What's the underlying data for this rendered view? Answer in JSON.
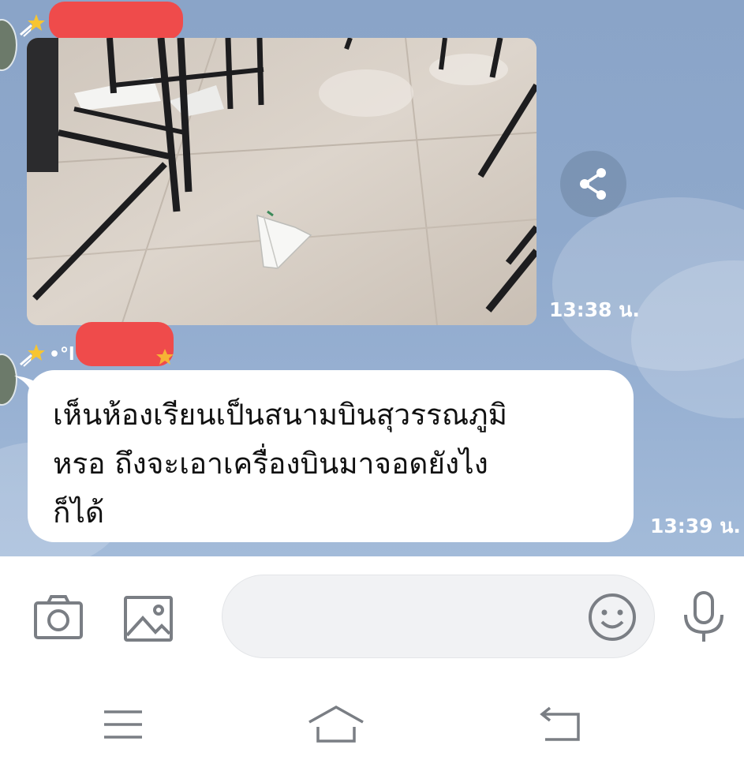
{
  "messages": [
    {
      "type": "image",
      "sender_prefix": "•",
      "timestamp": "13:38 น."
    },
    {
      "type": "text",
      "sender_prefix": "•°l",
      "lines": [
        "เห็นห้องเรียนเป็นสนามบินสุวรรณภูมิ",
        "หรอ ถึงจะเอาเครื่องบินมาจอดยังไง",
        "ก็ได้"
      ],
      "timestamp": "13:39 น."
    }
  ],
  "icons": {
    "sender_badge": "shooting-star-icon",
    "share": "share-icon",
    "camera": "camera-icon",
    "gallery": "image-icon",
    "emoji": "smiley-icon",
    "mic": "microphone-icon",
    "nav_menu": "menu-icon",
    "nav_home": "home-icon",
    "nav_back": "back-icon"
  },
  "colors": {
    "chat_background": "#8ea8cb",
    "bubble": "#ffffff",
    "redaction": "#ef4b4b",
    "icon_gray": "#7a7e84"
  }
}
